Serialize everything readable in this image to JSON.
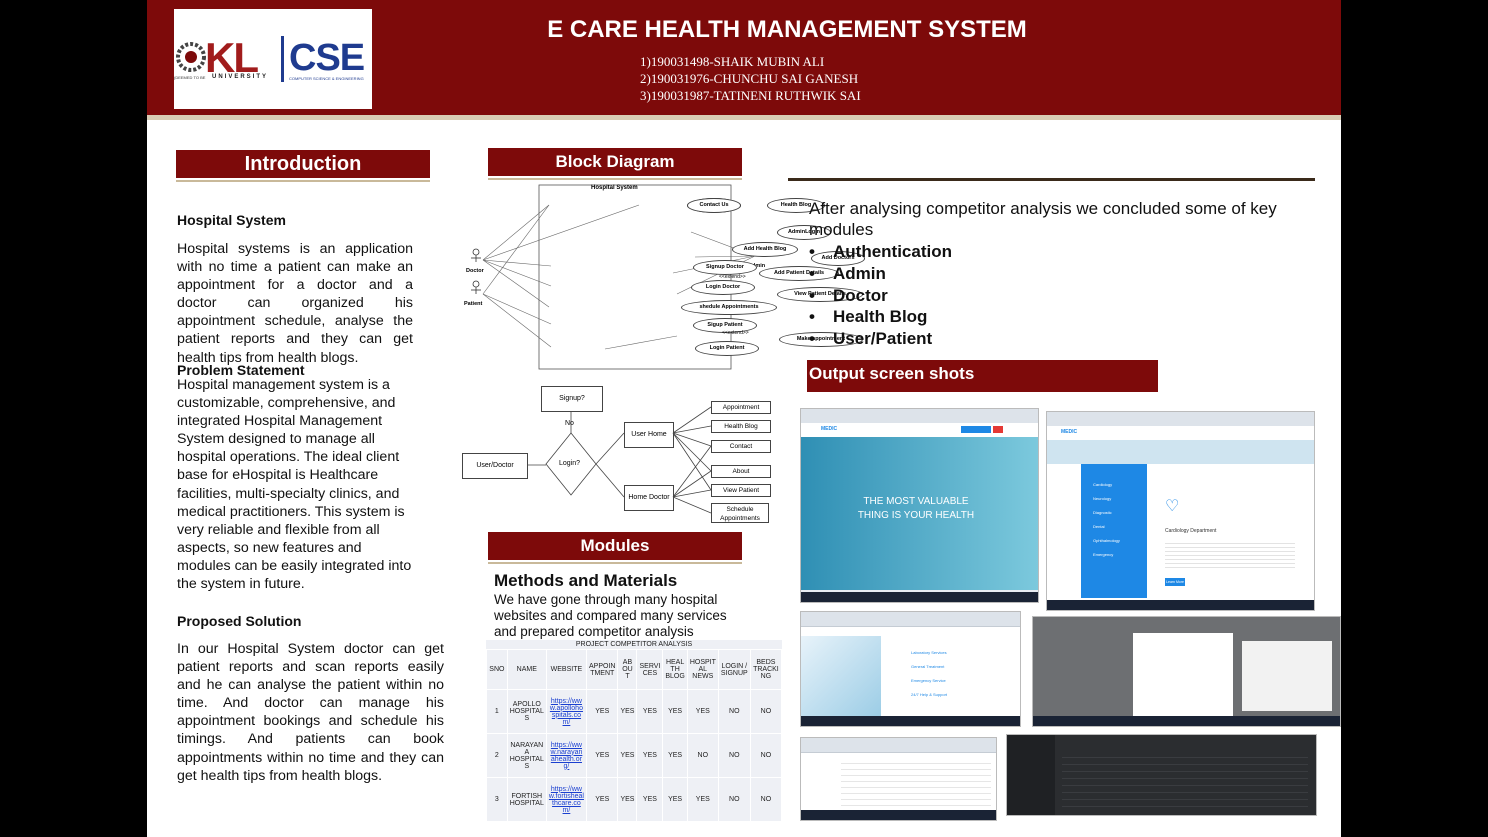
{
  "header": {
    "title": "E CARE HEALTH MANAGEMENT SYSTEM",
    "authors": [
      "1)190031498-SHAIK MUBIN ALI",
      "2)190031976-CHUNCHU SAI GANESH",
      "3)190031987-TATINENI RUTHWIK SAI"
    ],
    "logo": {
      "kl": "KL",
      "cse": "CSE",
      "university": "UNIVERSITY",
      "deemed": "(DEEMED TO BE",
      "cse_sub": "COMPUTER SCIENCE & ENGINEERING"
    }
  },
  "introduction": {
    "bar": "Introduction",
    "hospital_system_heading": "Hospital System",
    "hospital_system_text": "Hospital systems is an application with no time a patient can make an appointment for a doctor and a doctor can organized his appointment schedule, analyse the patient reports and they can get health tips from health blogs.",
    "problem_heading": "Problem Statement",
    "problem_text": "Hospital management system is a customizable, comprehensive, and integrated Hospital Management System designed to manage all hospital operations. The ideal client base for eHospital is Healthcare facilities, multi-specialty clinics, and medical practitioners. This system is very reliable and flexible from all aspects, so new features and modules can be easily integrated into the system in future.",
    "solution_heading": "Proposed Solution",
    "solution_text": "In our Hospital System doctor can get patient reports and scan reports easily and he can analyse the patient within no time. And doctor can manage his appointment bookings and schedule his timings. And patients can book appointments within no time and they can get health tips from health blogs."
  },
  "block_diagram": {
    "bar": "Block Diagram",
    "usecase": {
      "title": "Hospital System",
      "actors": [
        "Doctor",
        "Patient",
        "Admin"
      ],
      "cases": [
        "Contact Us",
        "Health Blog",
        "AdminLogin",
        "Add Health Blog",
        "Add Doctors",
        "Signup Doctor",
        "Add Patient Details",
        "Login Doctor",
        "View Patient Details",
        "shedule Appointments",
        "Sigup Patient",
        "Login Patient",
        "Make appointment"
      ],
      "extend": "<<extend>>"
    },
    "flow": {
      "signup": "Signup?",
      "no": "No",
      "login": "Login?",
      "user": "User/Doctor",
      "user_home": "User Home",
      "home_doctor": "Home Doctor",
      "items": [
        "Appointment",
        "Health Blog",
        "Contact",
        "About",
        "View Patient",
        "Schedule Appointments"
      ]
    }
  },
  "modules": {
    "bar": "Modules",
    "methods_heading": "Methods and Materials",
    "methods_text": "We have gone through many hospital websites and compared many services and  prepared competitor analysis"
  },
  "competitor_table": {
    "title": "PROJECT COMPETITOR ANALYSIS",
    "headers": [
      "SNO",
      "NAME",
      "WEBSITE",
      "APPOIN TMENT",
      "AB OU T",
      "SERVI CES",
      "HEAL TH BLOG",
      "HOSPIT AL NEWS",
      "LOGIN / SIGNUP",
      "BEDS TRACKI NG"
    ],
    "rows": [
      [
        "1",
        "APOLLO HOSPITAL S",
        "https://www.apollohospitals.com/",
        "YES",
        "YES",
        "YES",
        "YES",
        "YES",
        "NO",
        "NO"
      ],
      [
        "2",
        "NARAYAN A HOSPITAL S",
        "https://www.narayanahealth.org/",
        "YES",
        "YES",
        "YES",
        "YES",
        "NO",
        "NO",
        "NO"
      ],
      [
        "3",
        "FORTISH HOSPITAL",
        "https://www.fortishealthcare.com/",
        "YES",
        "YES",
        "YES",
        "YES",
        "YES",
        "NO",
        "NO"
      ]
    ]
  },
  "conclusion": {
    "intro": "After analysing competitor analysis we  concluded some of key modules",
    "modules": [
      "Authentication",
      "Admin",
      "Doctor",
      "Health Blog",
      "User/Patient"
    ]
  },
  "output": {
    "bar": "Output screen shots",
    "hero_text": "THE MOST VALUABLE THING IS YOUR HEALTH",
    "dept_title": "Cardiology Department",
    "sidebar_items": [
      "Cardiology",
      "Neurology",
      "Diagnostic",
      "Dental",
      "Ophthalmology",
      "Emergency"
    ],
    "services": [
      "Laboratory Services",
      "General Treatment",
      "Emergency Service",
      "24/7 Help & Support"
    ],
    "brand": "MEDIC",
    "learn_more": "Learn More"
  },
  "colors": {
    "maroon": "#7d0a0a",
    "rule": "#c9b99a",
    "link": "#1a3fd0",
    "hero": "#3aa7c9",
    "blue": "#1e88e5"
  }
}
